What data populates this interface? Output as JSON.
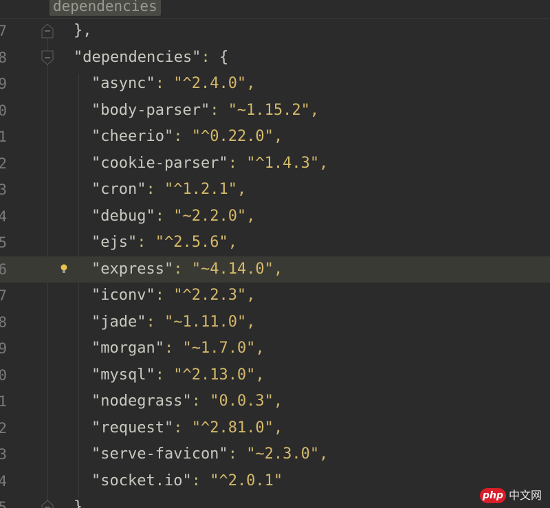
{
  "breadcrumb": {
    "label": "dependencies"
  },
  "colors": {
    "background": "#2b2b2b",
    "string": "#d4b96a",
    "key": "#c8c8c0",
    "current_line": "#3a3a34"
  },
  "lines": [
    {
      "num": "7",
      "fold": true,
      "indent": 0,
      "text": "},"
    },
    {
      "num": "8",
      "fold": true,
      "indent": 0,
      "key": "\"dependencies\"",
      "sep": ": ",
      "rest": "{"
    },
    {
      "num": "9",
      "indent": 1,
      "key": "\"async\"",
      "sep": ": ",
      "value": "\"^2.4.0\"",
      "end": ","
    },
    {
      "num": "0",
      "indent": 1,
      "key": "\"body-parser\"",
      "sep": ": ",
      "value": "\"~1.15.2\"",
      "end": ","
    },
    {
      "num": "1",
      "indent": 1,
      "key": "\"cheerio\"",
      "sep": ": ",
      "value": "\"^0.22.0\"",
      "end": ","
    },
    {
      "num": "2",
      "indent": 1,
      "key": "\"cookie-parser\"",
      "sep": ": ",
      "value": "\"^1.4.3\"",
      "end": ","
    },
    {
      "num": "3",
      "indent": 1,
      "key": "\"cron\"",
      "sep": ": ",
      "value": "\"^1.2.1\"",
      "end": ","
    },
    {
      "num": "4",
      "indent": 1,
      "key": "\"debug\"",
      "sep": ": ",
      "value": "\"~2.2.0\"",
      "end": ","
    },
    {
      "num": "5",
      "indent": 1,
      "key": "\"ejs\"",
      "sep": ": ",
      "value": "\"^2.5.6\"",
      "end": ","
    },
    {
      "num": "6",
      "indent": 1,
      "key": "\"express\"",
      "sep": ": ",
      "value": "\"~4.14.0\"",
      "end": ",",
      "current": true,
      "bulb": true
    },
    {
      "num": "7",
      "indent": 1,
      "key": "\"iconv\"",
      "sep": ": ",
      "value": "\"^2.2.3\"",
      "end": ","
    },
    {
      "num": "8",
      "indent": 1,
      "key": "\"jade\"",
      "sep": ": ",
      "value": "\"~1.11.0\"",
      "end": ","
    },
    {
      "num": "9",
      "indent": 1,
      "key": "\"morgan\"",
      "sep": ": ",
      "value": "\"~1.7.0\"",
      "end": ","
    },
    {
      "num": "0",
      "indent": 1,
      "key": "\"mysql\"",
      "sep": ": ",
      "value": "\"^2.13.0\"",
      "end": ","
    },
    {
      "num": "1",
      "indent": 1,
      "key": "\"nodegrass\"",
      "sep": ": ",
      "value": "\"0.0.3\"",
      "end": ","
    },
    {
      "num": "2",
      "indent": 1,
      "key": "\"request\"",
      "sep": ": ",
      "value": "\"^2.81.0\"",
      "end": ","
    },
    {
      "num": "3",
      "indent": 1,
      "key": "\"serve-favicon\"",
      "sep": ": ",
      "value": "\"~2.3.0\"",
      "end": ","
    },
    {
      "num": "4",
      "indent": 1,
      "key": "\"socket.io\"",
      "sep": ": ",
      "value": "\"^2.0.1\"",
      "end": ""
    },
    {
      "num": "5",
      "fold": true,
      "indent": 0,
      "text": "}"
    }
  ],
  "watermark": {
    "badge": "php",
    "text": "中文网"
  }
}
